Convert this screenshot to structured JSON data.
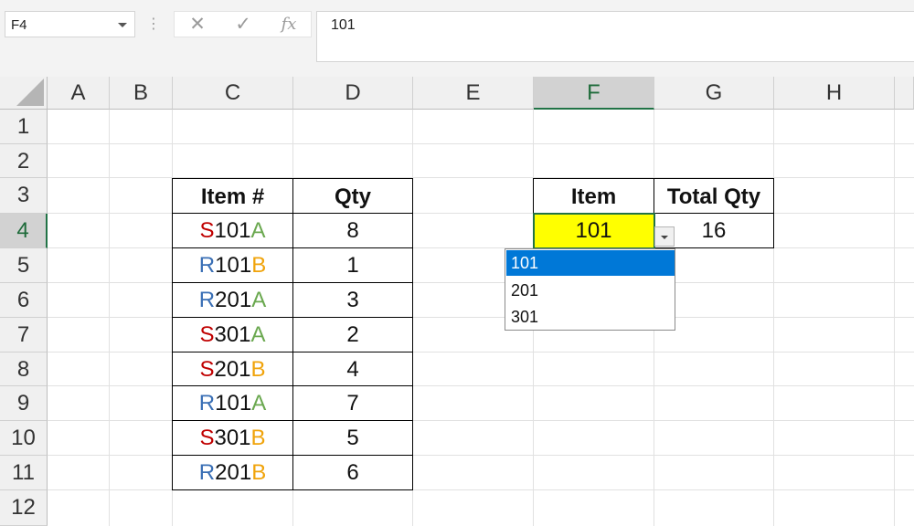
{
  "formula_bar": {
    "name_box": "F4",
    "separator": "⋮",
    "cancel": "✕",
    "enter": "✓",
    "fx": "fx",
    "formula": "101"
  },
  "columns": [
    "A",
    "B",
    "C",
    "D",
    "E",
    "F",
    "G",
    "H"
  ],
  "rows": [
    "1",
    "2",
    "3",
    "4",
    "5",
    "6",
    "7",
    "8",
    "9",
    "10",
    "11",
    "12"
  ],
  "active_cell": {
    "column": "F",
    "row": "4"
  },
  "colors": {
    "prefix_s": "#c00000",
    "prefix_r": "#3a6fb5",
    "suffix_a": "#6aa84f",
    "suffix_b": "#f0a30a",
    "highlight": "#ffff00",
    "selection": "#217346",
    "dropdown_selected": "#0078d7"
  },
  "inventory_table": {
    "header": {
      "item": "Item #",
      "qty": "Qty"
    },
    "rows": [
      {
        "prefix": "S",
        "number": "101",
        "suffix": "A",
        "qty": "8"
      },
      {
        "prefix": "R",
        "number": "101",
        "suffix": "B",
        "qty": "1"
      },
      {
        "prefix": "R",
        "number": "201",
        "suffix": "A",
        "qty": "3"
      },
      {
        "prefix": "S",
        "number": "301",
        "suffix": "A",
        "qty": "2"
      },
      {
        "prefix": "S",
        "number": "201",
        "suffix": "B",
        "qty": "4"
      },
      {
        "prefix": "R",
        "number": "101",
        "suffix": "A",
        "qty": "7"
      },
      {
        "prefix": "S",
        "number": "301",
        "suffix": "B",
        "qty": "5"
      },
      {
        "prefix": "R",
        "number": "201",
        "suffix": "B",
        "qty": "6"
      }
    ]
  },
  "summary_table": {
    "header": {
      "item": "Item",
      "total": "Total Qty"
    },
    "item_value": "101",
    "total_value": "16"
  },
  "dropdown": {
    "options": [
      "101",
      "201",
      "301"
    ],
    "selected": "101"
  }
}
